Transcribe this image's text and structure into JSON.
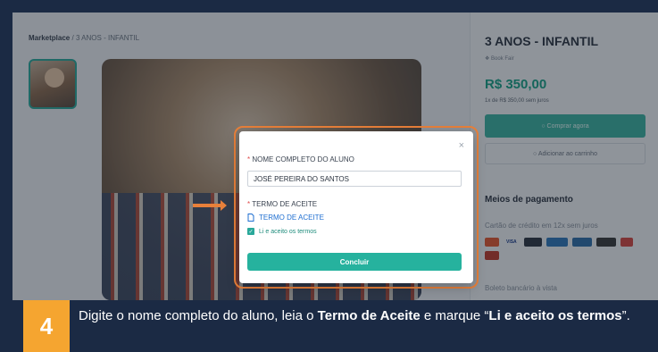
{
  "breadcrumb": {
    "root": "Marketplace",
    "sep": "/",
    "current": "3 ANOS - INFANTIL"
  },
  "product": {
    "title": "3 ANOS - INFANTIL",
    "seller": "Book Fair",
    "price": "R$ 350,00",
    "installments": "1x de R$ 350,00 sem juros",
    "buy_label": "Comprar agora",
    "cart_label": "Adicionar ao carrinho"
  },
  "payment": {
    "title": "Meios de pagamento",
    "card_text": "Cartão de crédito em 12x sem juros",
    "cards": [
      "mastercard",
      "VISA",
      "diners",
      "amex",
      "discover",
      "JCB",
      "other"
    ],
    "boleto_text": "Boleto bancário à vista"
  },
  "modal": {
    "name_label": "NOME COMPLETO DO ALUNO",
    "name_value": "JOSÉ PEREIRA DO SANTOS",
    "term_label": "TERMO DE ACEITE",
    "term_link": "TERMO DE ACEITE",
    "check_label": "Li e aceito os termos",
    "conclude_label": "Concluir",
    "close_glyph": "×",
    "required_mark": "*"
  },
  "instruction": {
    "step": "4",
    "part1": "Digite o nome completo do aluno, leia o ",
    "bold1": "Termo de Aceite",
    "part2": " e marque “",
    "bold2": "Li e aceito os termos",
    "part3": "”."
  },
  "colors": {
    "accent": "#26b29e",
    "highlight": "#e8803a",
    "step_badge": "#f5a530",
    "banner": "#1b2a44"
  }
}
